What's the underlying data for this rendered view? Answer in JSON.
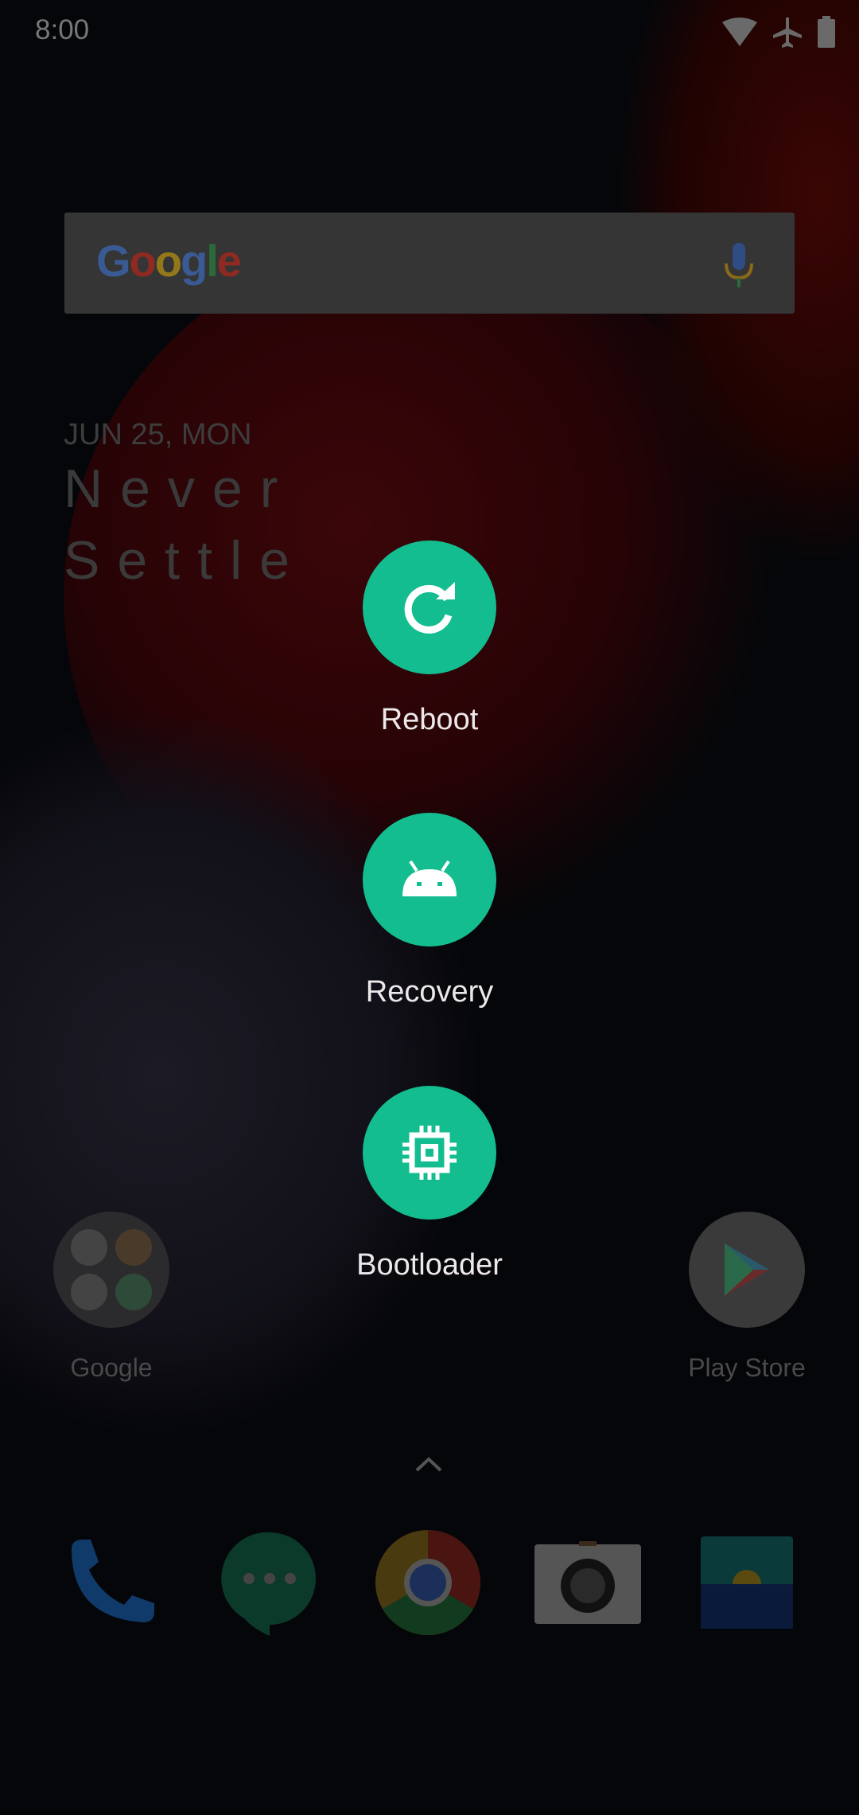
{
  "status_bar": {
    "time": "8:00",
    "icons": [
      "wifi-icon",
      "airplane-icon",
      "battery-icon"
    ]
  },
  "search_widget": {
    "logo": "Google",
    "icon": "mic-icon"
  },
  "clock_widget": {
    "date": "JUN 25, MON",
    "motto_line1": "Never",
    "motto_line2": "Settle"
  },
  "power_menu": {
    "accent": "#14bd8f",
    "options": [
      {
        "label": "Reboot",
        "icon": "reboot-icon"
      },
      {
        "label": "Recovery",
        "icon": "android-icon"
      },
      {
        "label": "Bootloader",
        "icon": "chip-icon"
      }
    ]
  },
  "home_apps": [
    {
      "label": "Google"
    },
    {
      "label": "Play Store"
    }
  ],
  "dock": {
    "items": [
      "phone",
      "messages",
      "chrome",
      "camera",
      "gallery"
    ]
  }
}
